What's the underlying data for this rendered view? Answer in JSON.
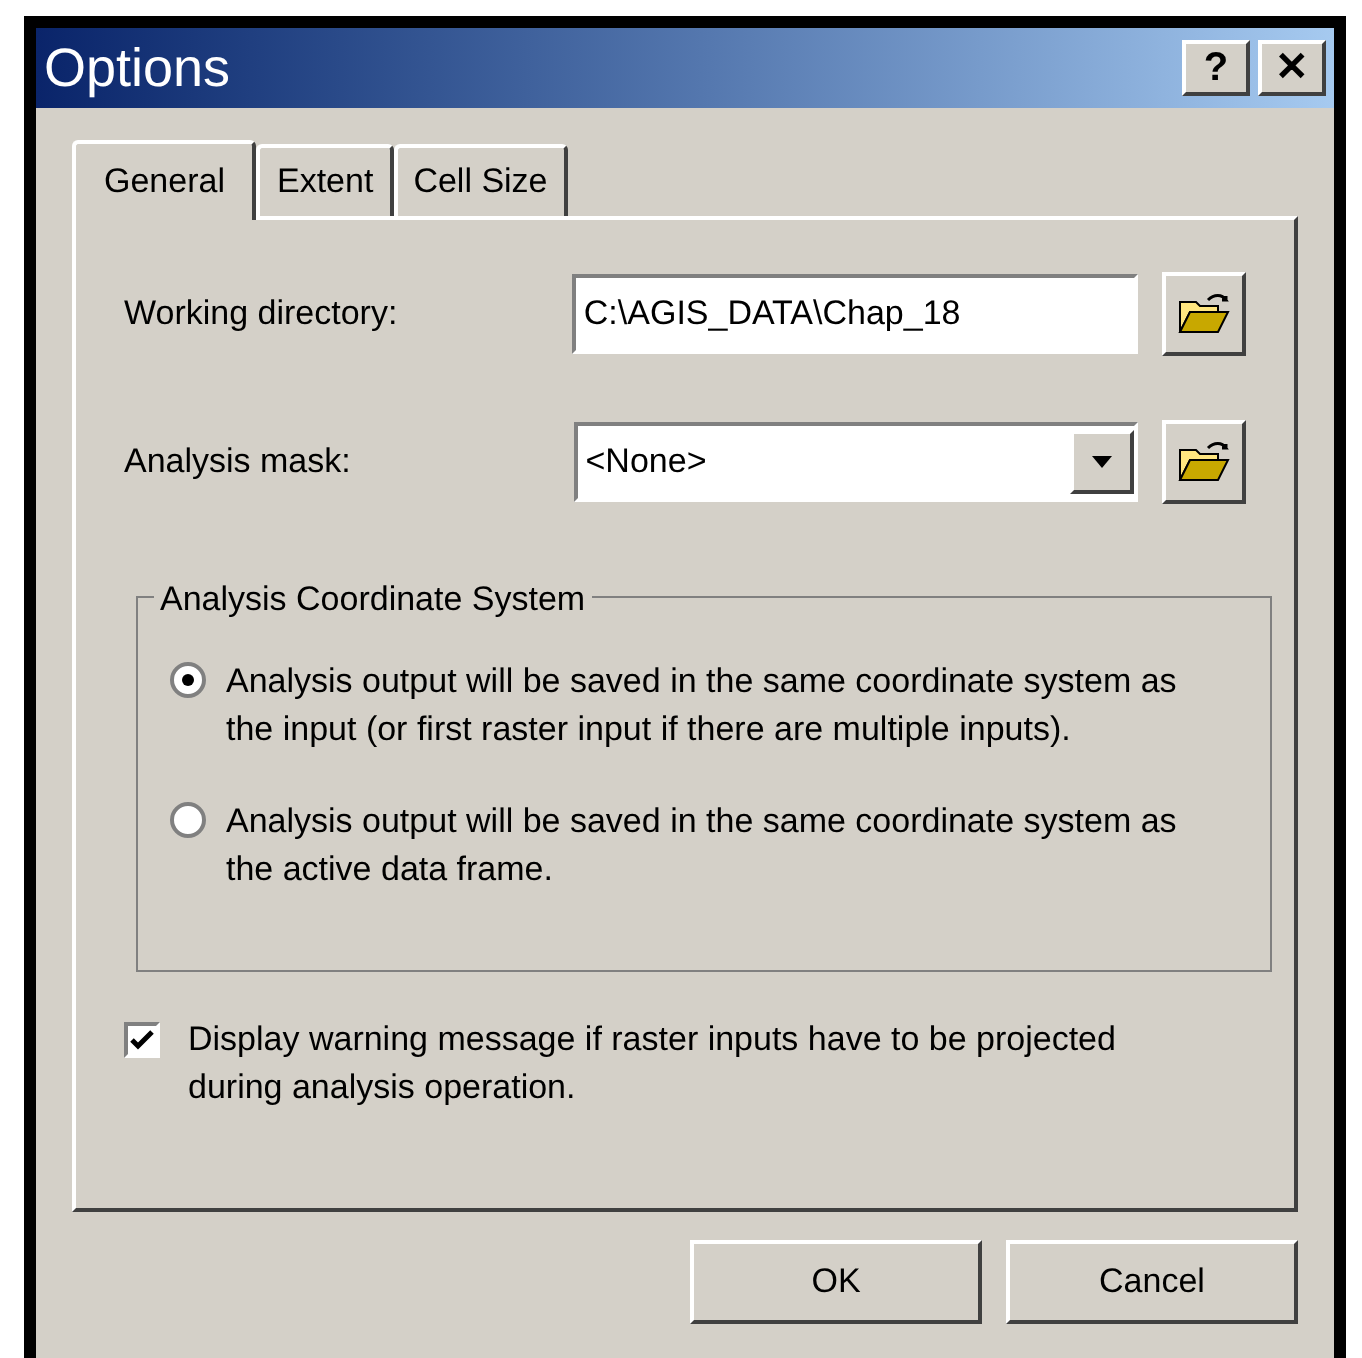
{
  "window": {
    "title": "Options",
    "title_buttons": [
      "?",
      "✕"
    ]
  },
  "tabs": [
    {
      "label": "General",
      "selected": true
    },
    {
      "label": "Extent",
      "selected": false
    },
    {
      "label": "Cell Size",
      "selected": false
    }
  ],
  "fields": [
    {
      "kind": "text",
      "label": "Working directory:",
      "value": "C:\\AGIS_DATA\\Chap_18"
    },
    {
      "kind": "dropdown",
      "label": "Analysis mask:",
      "value": "<None>"
    }
  ],
  "group": {
    "title": "Analysis Coordinate System",
    "options": [
      {
        "label": "Analysis output will be saved in the same coordinate system as the input (or first raster input if there are multiple inputs).",
        "selected": true
      },
      {
        "label": "Analysis output will be saved in the same coordinate system as the active data frame.",
        "selected": false
      }
    ]
  },
  "checkbox": {
    "label": "Display warning message if raster inputs have to be projected during analysis operation.",
    "checked": true
  },
  "buttons": [
    "OK",
    "Cancel"
  ]
}
